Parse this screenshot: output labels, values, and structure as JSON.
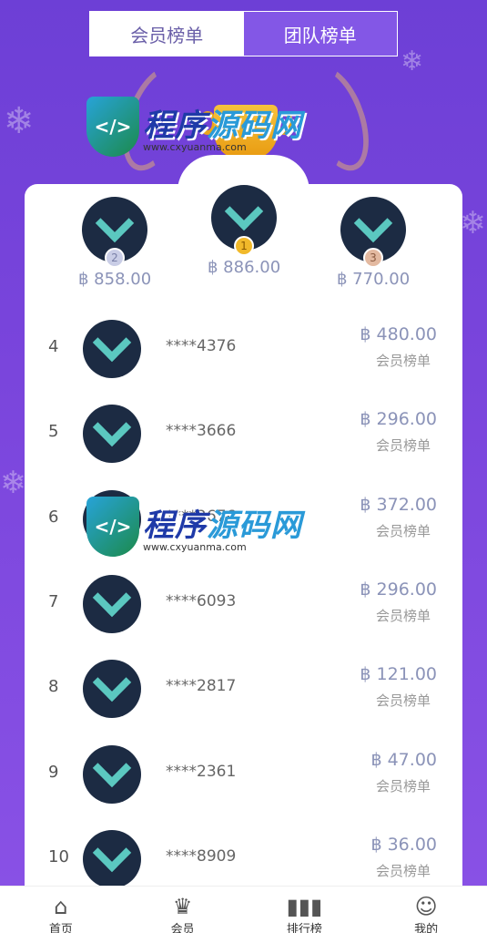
{
  "tabs": [
    {
      "label": "会员榜单",
      "active": true
    },
    {
      "label": "团队榜单",
      "active": false
    }
  ],
  "podium": [
    {
      "rank": "2",
      "amount": "฿ 858.00",
      "medal": "silver"
    },
    {
      "rank": "1",
      "amount": "฿ 886.00",
      "medal": "gold"
    },
    {
      "rank": "3",
      "amount": "฿ 770.00",
      "medal": "bronze"
    }
  ],
  "rows": [
    {
      "rank": "4",
      "uid": "****4376",
      "amount": "฿ 480.00",
      "label": "会员榜单"
    },
    {
      "rank": "5",
      "uid": "****3666",
      "amount": "฿ 296.00",
      "label": "会员榜单"
    },
    {
      "rank": "6",
      "uid": "****2676",
      "amount": "฿ 372.00",
      "label": "会员榜单"
    },
    {
      "rank": "7",
      "uid": "****6093",
      "amount": "฿ 296.00",
      "label": "会员榜单"
    },
    {
      "rank": "8",
      "uid": "****2817",
      "amount": "฿ 121.00",
      "label": "会员榜单"
    },
    {
      "rank": "9",
      "uid": "****2361",
      "amount": "฿ 47.00",
      "label": "会员榜单"
    },
    {
      "rank": "10",
      "uid": "****8909",
      "amount": "฿ 36.00",
      "label": "会员榜单"
    }
  ],
  "watermark": {
    "title_a": "程序",
    "title_b": "源码网",
    "url": "www.cxyuanma.com"
  },
  "nav": [
    {
      "icon": "home-icon",
      "label": "首页"
    },
    {
      "icon": "crown-icon",
      "label": "会员"
    },
    {
      "icon": "chart-icon",
      "label": "排行榜"
    },
    {
      "icon": "user-icon",
      "label": "我的"
    }
  ],
  "colors": {
    "primary": "#7a45dc",
    "avatar_bg": "#1c2b43",
    "accent": "#5bc8c0",
    "amount": "#8b93b8"
  }
}
